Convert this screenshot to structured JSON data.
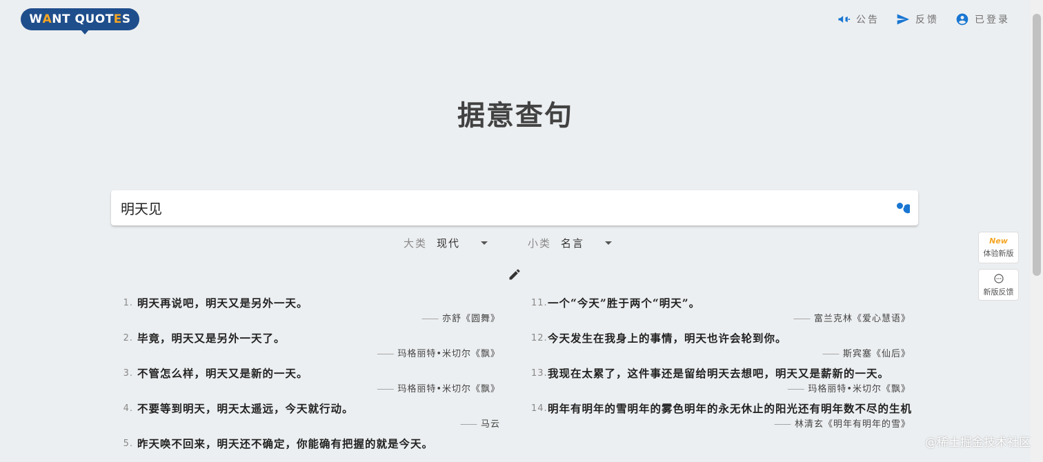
{
  "header": {
    "logo": {
      "part1": "W",
      "accent1": "A",
      "part2": "NT QUOT",
      "accent2": "E",
      "part3": "S"
    },
    "nav": [
      {
        "label": "公告",
        "icon": "megaphone-icon"
      },
      {
        "label": "反馈",
        "icon": "send-icon"
      },
      {
        "label": "已登录",
        "icon": "user-icon"
      }
    ]
  },
  "title": "据意查句",
  "search": {
    "value": "明天见",
    "icon": "search-icon"
  },
  "filters": {
    "major": {
      "label": "大类",
      "value": "现代"
    },
    "minor": {
      "label": "小类",
      "value": "名言"
    }
  },
  "quotes_left": [
    {
      "num": "1.",
      "text": "明天再说吧，明天又是另外一天。",
      "source": "亦舒《圆舞》"
    },
    {
      "num": "2.",
      "text": "毕竟，明天又是另外一天了。",
      "source": "玛格丽特•米切尔《飘》"
    },
    {
      "num": "3.",
      "text": "不管怎么样，明天又是新的一天。",
      "source": "玛格丽特•米切尔《飘》"
    },
    {
      "num": "4.",
      "text": "不要等到明天，明天太遥远，今天就行动。",
      "source": "马云"
    },
    {
      "num": "5.",
      "text": "昨天唤不回来，明天还不确定，你能确有把握的就是今天。",
      "source": ""
    }
  ],
  "quotes_right": [
    {
      "num": "11.",
      "text": "一个“今天”胜于两个“明天”。",
      "source": "富兰克林《爱心慧语》"
    },
    {
      "num": "12.",
      "text": "今天发生在我身上的事情，明天也许会轮到你。",
      "source": "斯宾塞《仙后》"
    },
    {
      "num": "13.",
      "text": "我现在太累了，这件事还是留给明天去想吧，明天又是薪新的一天。",
      "source": "玛格丽特•米切尔《飘》"
    },
    {
      "num": "14.",
      "text": "明年有明年的雪明年的雾色明年的永无休止的阳光还有明年数不尽的生机",
      "source": "林清玄《明年有明年的雪》"
    }
  ],
  "dash": "——",
  "float_buttons": {
    "new_badge": "New",
    "try_new": "体验新版",
    "feedback": "新版反馈"
  },
  "watermark": "@稀土掘金技术社区"
}
